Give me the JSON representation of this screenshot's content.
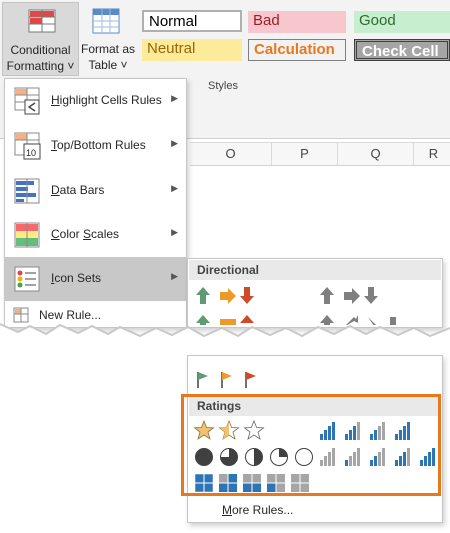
{
  "ribbon": {
    "conditional_formatting": {
      "line1": "Conditional",
      "line2": "Formatting",
      "caret": "˅"
    },
    "format_as_table": {
      "line1": "Format as",
      "line2": "Table",
      "caret": "˅"
    },
    "styles": [
      "Normal",
      "Bad",
      "Good",
      "Neutral",
      "Calculation",
      "Check Cell"
    ],
    "group_label": "Styles"
  },
  "columns": [
    "O",
    "P",
    "Q",
    "R"
  ],
  "menu": {
    "items": [
      {
        "label": "Highlight Cells Rules",
        "icon": "highlight-cells-icon"
      },
      {
        "label": "Top/Bottom Rules",
        "icon": "top-bottom-icon",
        "icon_text": "10"
      },
      {
        "label": "Data Bars",
        "icon": "data-bars-icon"
      },
      {
        "label": "Color Scales",
        "icon": "color-scales-icon"
      },
      {
        "label": "Icon Sets",
        "icon": "icon-sets-icon"
      }
    ],
    "new_rule": "New Rule..."
  },
  "submenu": {
    "directional_header": "Directional",
    "ratings_header": "Ratings",
    "more_rules": "More Rules..."
  },
  "colors": {
    "accent": "#e8781e",
    "green": "#5e9a73",
    "orange": "#ec9b2a",
    "red": "#d04a2a",
    "gray": "#7f7f7f",
    "blue": "#2e75b6"
  }
}
